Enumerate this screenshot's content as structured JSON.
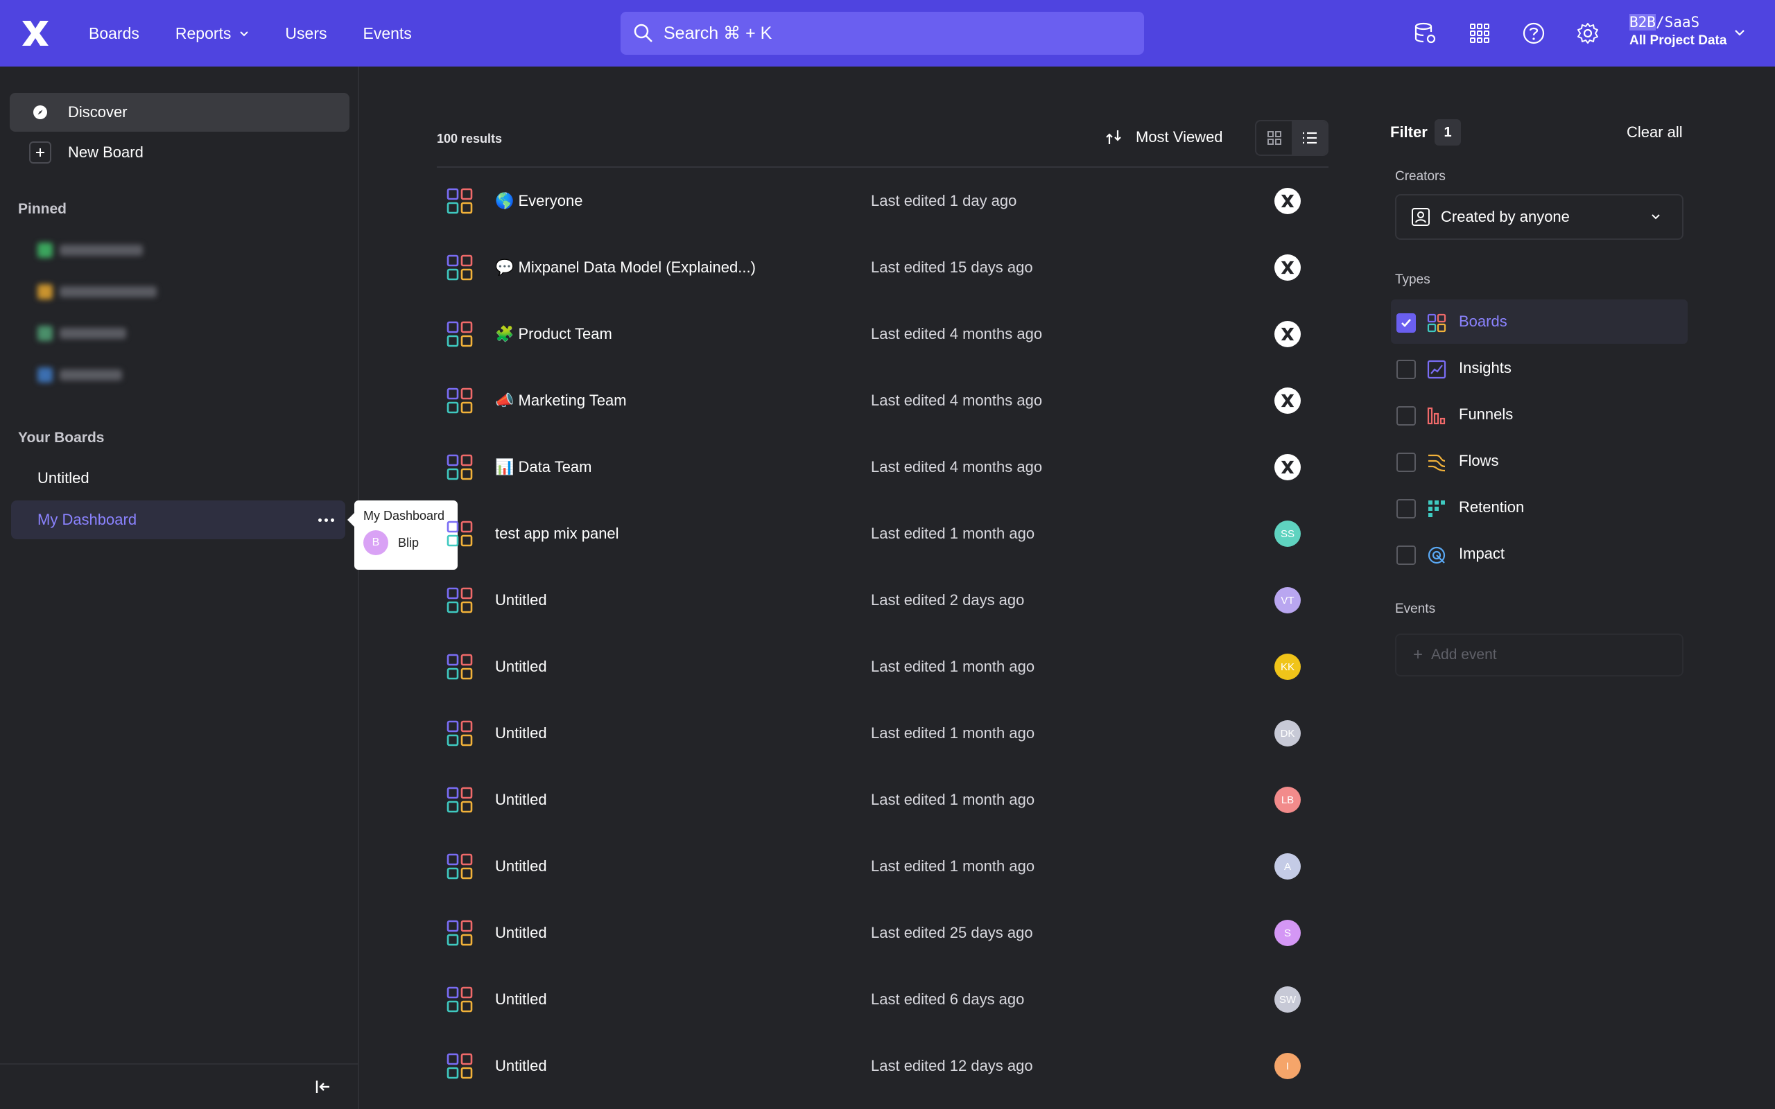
{
  "topbar": {
    "nav": [
      {
        "label": "Boards"
      },
      {
        "label": "Reports"
      },
      {
        "label": "Users"
      },
      {
        "label": "Events"
      }
    ],
    "search_label": "Search  ⌘ + K",
    "project_name_hl": "B2B",
    "project_name_rest": "/SaaS",
    "project_sub": "All Project Data"
  },
  "sidebar": {
    "discover": "Discover",
    "new_board": "New Board",
    "pinned_heading": "Pinned",
    "your_boards_heading": "Your Boards",
    "boards": [
      {
        "label": "Untitled"
      },
      {
        "label": "My Dashboard"
      }
    ]
  },
  "tooltip": {
    "title": "My Dashboard",
    "user_initial": "B",
    "user_name": "Blip"
  },
  "list": {
    "results": "100 results",
    "sort_label": "Most Viewed",
    "rows": [
      {
        "name": "🌎 Everyone",
        "edited": "Last edited 1 day ago",
        "avatar": "",
        "avatar_color": "mp"
      },
      {
        "name": "💬 Mixpanel Data Model (Explained...)",
        "edited": "Last edited 15 days ago",
        "avatar": "",
        "avatar_color": "mp"
      },
      {
        "name": "🧩 Product Team",
        "edited": "Last edited 4 months ago",
        "avatar": "",
        "avatar_color": "mp"
      },
      {
        "name": "📣 Marketing Team",
        "edited": "Last edited 4 months ago",
        "avatar": "",
        "avatar_color": "mp"
      },
      {
        "name": "📊 Data Team",
        "edited": "Last edited 4 months ago",
        "avatar": "",
        "avatar_color": "mp"
      },
      {
        "name": "test app mix panel",
        "edited": "Last edited 1 month ago",
        "avatar": "SS",
        "avatar_color": "#5fd3c0"
      },
      {
        "name": "Untitled",
        "edited": "Last edited 2 days ago",
        "avatar": "VT",
        "avatar_color": "#b9a6f0"
      },
      {
        "name": "Untitled",
        "edited": "Last edited 1 month ago",
        "avatar": "KK",
        "avatar_color": "#f0c419"
      },
      {
        "name": "Untitled",
        "edited": "Last edited 1 month ago",
        "avatar": "DK",
        "avatar_color": "#c7c9d6"
      },
      {
        "name": "Untitled",
        "edited": "Last edited 1 month ago",
        "avatar": "LB",
        "avatar_color": "#f28b8b"
      },
      {
        "name": "Untitled",
        "edited": "Last edited 1 month ago",
        "avatar": "A",
        "avatar_color": "#c4cbe6"
      },
      {
        "name": "Untitled",
        "edited": "Last edited 25 days ago",
        "avatar": "S",
        "avatar_color": "#d497f5"
      },
      {
        "name": "Untitled",
        "edited": "Last edited 6 days ago",
        "avatar": "SW",
        "avatar_color": "#c7c9d6"
      },
      {
        "name": "Untitled",
        "edited": "Last edited 12 days ago",
        "avatar": "I",
        "avatar_color": "#f5a56a"
      }
    ]
  },
  "filter": {
    "title": "Filter",
    "count": "1",
    "clear_all": "Clear all",
    "creators_label": "Creators",
    "creators_value": "Created by anyone",
    "types_label": "Types",
    "types": [
      {
        "label": "Boards",
        "checked": true,
        "icon": "boards-icon"
      },
      {
        "label": "Insights",
        "checked": false,
        "icon": "insights-icon"
      },
      {
        "label": "Funnels",
        "checked": false,
        "icon": "funnels-icon"
      },
      {
        "label": "Flows",
        "checked": false,
        "icon": "flows-icon"
      },
      {
        "label": "Retention",
        "checked": false,
        "icon": "retention-icon"
      },
      {
        "label": "Impact",
        "checked": false,
        "icon": "impact-icon"
      }
    ],
    "events_label": "Events",
    "add_event": "Add event"
  },
  "colors": {
    "brand": "#4f44e0",
    "accent": "#8b83ff",
    "background": "#232428"
  }
}
